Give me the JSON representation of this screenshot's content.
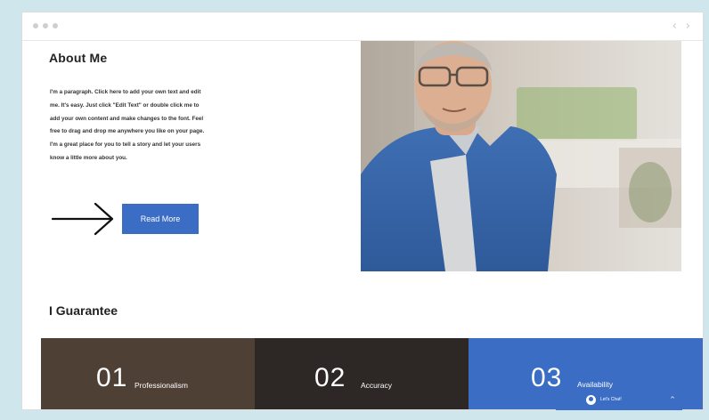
{
  "window": {
    "nav_prev": "‹",
    "nav_next": "›"
  },
  "about": {
    "title": "About Me",
    "paragraph": "I'm a paragraph. Click here to add your own text and edit me. It's easy. Just click \"Edit Text\" or double click me to add your own content and make changes to the font. Feel free to drag and drop me anywhere you like on your page. I'm a great place for you to tell a story and let your users know a little more about you.",
    "button_label": "Read More"
  },
  "guarantee": {
    "title": "I Guarantee",
    "items": [
      {
        "number": "01",
        "label": "Professionalism"
      },
      {
        "number": "02",
        "label": "Accuracy"
      },
      {
        "number": "03",
        "label": "Availability"
      }
    ]
  },
  "chat": {
    "label": "Let's Chat!",
    "chevron": "^"
  },
  "colors": {
    "accent_blue": "#3a6dc3",
    "feature_brown": "#4f4036",
    "feature_dark": "#2d2826",
    "page_background": "#cfe6ec"
  },
  "icons": {
    "arrow": "arrow-right-icon",
    "chat": "user-icon"
  }
}
